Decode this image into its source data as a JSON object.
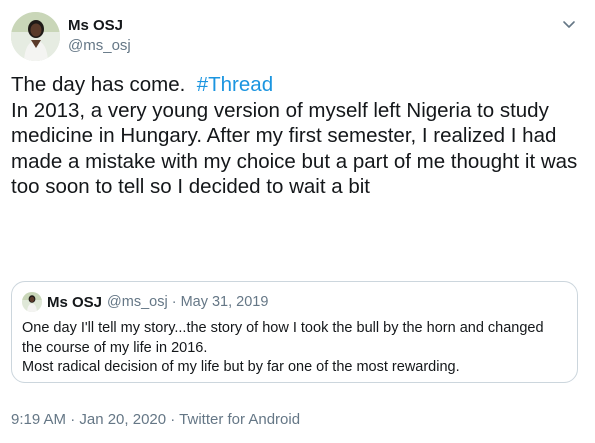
{
  "tweet": {
    "author": {
      "display_name": "Ms OSJ",
      "handle": "@ms_osj"
    },
    "text_line_1": "The day has come.  ",
    "hashtag": "#Thread",
    "text_body": "In 2013, a very young version of myself left Nigeria to study medicine in Hungary. After my first semester, I realized I had made a mistake with my choice but a part of me thought it was too soon to tell so I decided to wait a bit",
    "quoted_tweet": {
      "display_name": "Ms OSJ",
      "meta": "@ms_osj · May 31, 2019",
      "text_line_1": "One day I'll tell my story...the story of how I took the bull by the horn and changed the course of my life in 2016.",
      "text_line_2": "Most radical decision of my life but by far one of the most rewarding."
    },
    "timestamp": "9:19 AM · Jan 20, 2020 · ",
    "source": "Twitter for Android",
    "icons": {
      "more_options": "chevron-down-icon",
      "avatar": "profile-photo"
    },
    "colors": {
      "hashtag": "#1b95e0",
      "secondary_text": "#657786",
      "primary_text": "#14171a",
      "quote_border": "#ccd6dd"
    }
  }
}
